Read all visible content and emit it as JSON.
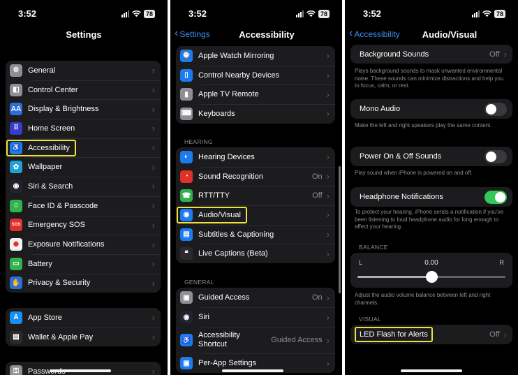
{
  "status": {
    "time": "3:52",
    "battery": "78"
  },
  "panel1": {
    "title": "Settings",
    "group1": [
      {
        "label": "General",
        "icon": "gear-icon",
        "color": "#8e8e93",
        "glyph": "⚙"
      },
      {
        "label": "Control Center",
        "icon": "toggles-icon",
        "color": "#8e8e93",
        "glyph": "◧"
      },
      {
        "label": "Display & Brightness",
        "icon": "display-icon",
        "color": "#2f6ed8",
        "glyph": "AA"
      },
      {
        "label": "Home Screen",
        "icon": "home-screen-icon",
        "color": "#3b3bc9",
        "glyph": "⠿"
      },
      {
        "label": "Accessibility",
        "icon": "accessibility-icon",
        "color": "#1a7cf0",
        "glyph": "♿",
        "highlighted": true
      },
      {
        "label": "Wallpaper",
        "icon": "wallpaper-icon",
        "color": "#1ea0d8",
        "glyph": "✿"
      },
      {
        "label": "Siri & Search",
        "icon": "siri-icon",
        "color": "#222233",
        "glyph": "◉"
      },
      {
        "label": "Face ID & Passcode",
        "icon": "face-id-icon",
        "color": "#2fb34a",
        "glyph": "☺"
      },
      {
        "label": "Emergency SOS",
        "icon": "sos-icon",
        "color": "#e0302a",
        "glyph": "SOS"
      },
      {
        "label": "Exposure Notifications",
        "icon": "exposure-icon",
        "color": "#f2f2f2",
        "glyph": "✺"
      },
      {
        "label": "Battery",
        "icon": "battery-icon",
        "color": "#2fb34a",
        "glyph": "▭"
      },
      {
        "label": "Privacy & Security",
        "icon": "hand-icon",
        "color": "#2f6ed8",
        "glyph": "✋"
      }
    ],
    "group2": [
      {
        "label": "App Store",
        "icon": "app-store-icon",
        "color": "#1a8ef0",
        "glyph": "A"
      },
      {
        "label": "Wallet & Apple Pay",
        "icon": "wallet-icon",
        "color": "#2b2b2e",
        "glyph": "▤"
      }
    ],
    "group3": [
      {
        "label": "Passwords",
        "icon": "key-icon",
        "color": "#8e8e93",
        "glyph": "⚿"
      }
    ]
  },
  "panel2": {
    "back": "Settings",
    "title": "Accessibility",
    "group1": [
      {
        "label": "Apple Watch Mirroring",
        "icon": "watch-icon",
        "color": "#1a7cf0",
        "glyph": "⌚"
      },
      {
        "label": "Control Nearby Devices",
        "icon": "nearby-devices-icon",
        "color": "#1a7cf0",
        "glyph": "▯"
      },
      {
        "label": "Apple TV Remote",
        "icon": "remote-icon",
        "color": "#8e8e93",
        "glyph": "▮"
      },
      {
        "label": "Keyboards",
        "icon": "keyboard-icon",
        "color": "#8e8e93",
        "glyph": "⌨"
      }
    ],
    "hearing_header": "HEARING",
    "hearing": [
      {
        "label": "Hearing Devices",
        "icon": "ear-icon",
        "color": "#1a7cf0",
        "glyph": "◐"
      },
      {
        "label": "Sound Recognition",
        "icon": "sound-recognition-icon",
        "color": "#e0302a",
        "glyph": "◔",
        "value": "On"
      },
      {
        "label": "RTT/TTY",
        "icon": "tty-icon",
        "color": "#2fb34a",
        "glyph": "☎",
        "value": "Off"
      },
      {
        "label": "Audio/Visual",
        "icon": "audio-visual-icon",
        "color": "#1a7cf0",
        "glyph": "◉",
        "highlighted": true
      },
      {
        "label": "Subtitles & Captioning",
        "icon": "captions-icon",
        "color": "#1a7cf0",
        "glyph": "▤"
      },
      {
        "label": "Live Captions (Beta)",
        "icon": "live-captions-icon",
        "color": "#2b2b2e",
        "glyph": "❝"
      }
    ],
    "general_header": "GENERAL",
    "general": [
      {
        "label": "Guided Access",
        "icon": "lock-icon",
        "color": "#8e8e93",
        "glyph": "▣",
        "value": "On"
      },
      {
        "label": "Siri",
        "icon": "siri-icon",
        "color": "#222233",
        "glyph": "◉"
      },
      {
        "label": "Accessibility\nShortcut",
        "icon": "accessibility-icon",
        "color": "#1a7cf0",
        "glyph": "♿",
        "value": "Guided Access"
      },
      {
        "label": "Per-App Settings",
        "icon": "per-app-icon",
        "color": "#1a7cf0",
        "glyph": "▣"
      }
    ]
  },
  "panel3": {
    "back": "Accessibility",
    "title": "Audio/Visual",
    "background_sounds": {
      "label": "Background Sounds",
      "value": "Off"
    },
    "background_sounds_note": "Plays background sounds to mask unwanted environmental noise. These sounds can minimize distractions and help you to focus, calm, or rest.",
    "mono_audio": {
      "label": "Mono Audio",
      "state": "off"
    },
    "mono_audio_note": "Make the left and right speakers play the same content.",
    "power_sounds": {
      "label": "Power On & Off Sounds",
      "state": "off"
    },
    "power_sounds_note": "Play sound when iPhone is powered on and off.",
    "headphone_notifications": {
      "label": "Headphone Notifications",
      "state": "on"
    },
    "headphone_note": "To protect your hearing, iPhone sends a notification if you've been listening to loud headphone audio for long enough to affect your hearing.",
    "balance_header": "BALANCE",
    "balance": {
      "left": "L",
      "right": "R",
      "value": "0.00",
      "position": 0.5
    },
    "balance_note": "Adjust the audio volume balance between left and right channels.",
    "visual_header": "VISUAL",
    "led_flash": {
      "label": "LED Flash for Alerts",
      "value": "Off",
      "highlighted": true
    }
  }
}
